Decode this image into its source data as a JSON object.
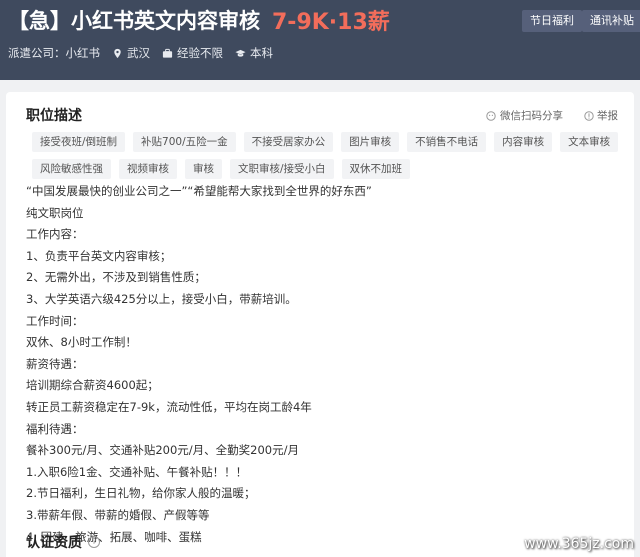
{
  "header": {
    "title": "【急】小红书英文内容审核",
    "salary": "7-9K·13薪",
    "tags": [
      "节日福利",
      "通讯补贴"
    ],
    "meta": {
      "company": "派遣公司：小红书",
      "location": "武汉",
      "experience": "经验不限",
      "education": "本科"
    }
  },
  "job": {
    "section_title": "职位描述",
    "share_label": "微信扫码分享",
    "report_label": "举报",
    "tags_row1": [
      "接受夜班/倒班制",
      "补贴700/五险一金",
      "不接受居家办公",
      "图片审核",
      "不销售不电话",
      "内容审核",
      "文本审核"
    ],
    "tags_row2": [
      "风险敏感性强",
      "视频审核",
      "审核",
      "文职审核/接受小白",
      "双休不加班"
    ],
    "description": [
      "“中国发展最快的创业公司之一”“希望能帮大家找到全世界的好东西”",
      "纯文职岗位",
      "工作内容：",
      "1、负责平台英文内容审核；",
      "2、无需外出，不涉及到销售性质；",
      "3、大学英语六级425分以上，接受小白，带薪培训。",
      "工作时间：",
      "双休、8小时工作制！",
      "薪资待遇：",
      "培训期综合薪资4600起；",
      "转正员工薪资稳定在7-9k，流动性低，平均在岗工龄4年",
      "福利待遇：",
      "餐补300元/月、交通补贴200元/月、全勤奖200元/月",
      "1.入职6险1金、交通补贴、午餐补贴！！！",
      "2.节日福利，生日礼物，给你家人般的温暖；",
      "3.带薪年假、带薪的婚假、产假等等",
      "4. 团建、旅游、拓展、咖啡、蛋糕"
    ],
    "cert_title": "认证资质"
  },
  "watermark": "www.365jz.com",
  "colors": {
    "header_bg": "#3f4a5e",
    "salary": "#f26d5b",
    "tag_bg": "#f2f3f5",
    "page_bg": "#f0f1f3"
  }
}
